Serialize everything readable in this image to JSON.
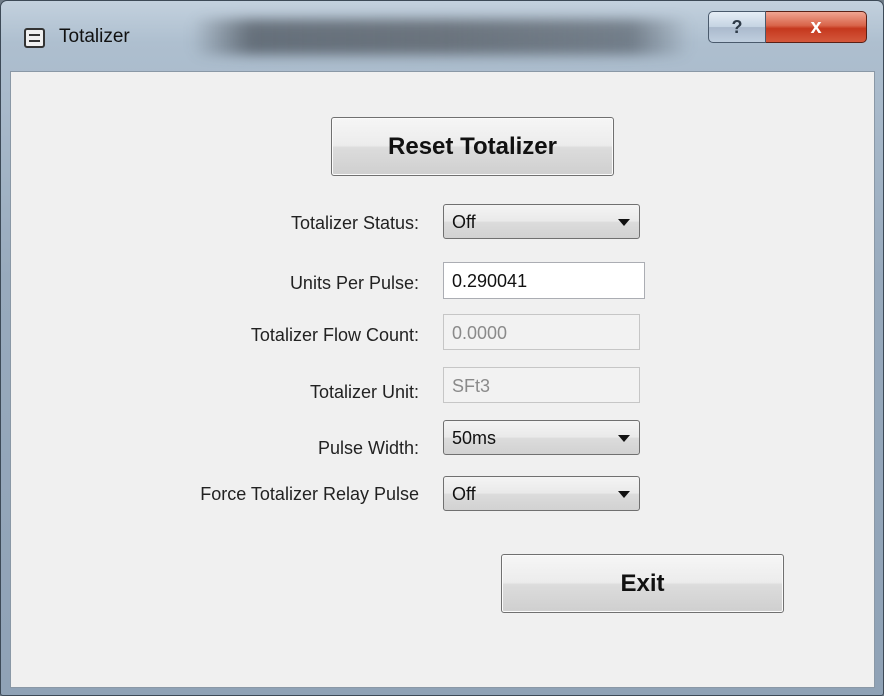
{
  "window": {
    "title": "Totalizer",
    "help_label": "?",
    "close_label": "x"
  },
  "buttons": {
    "reset_label": "Reset Totalizer",
    "exit_label": "Exit"
  },
  "fields": {
    "totalizer_status": {
      "label": "Totalizer Status:",
      "value": "Off"
    },
    "units_per_pulse": {
      "label": "Units Per Pulse:",
      "value": "0.290041"
    },
    "flow_count": {
      "label": "Totalizer Flow Count:",
      "value": "0.0000"
    },
    "totalizer_unit": {
      "label": "Totalizer Unit:",
      "value": "SFt3"
    },
    "pulse_width": {
      "label": "Pulse Width:",
      "value": "50ms"
    },
    "force_relay": {
      "label": "Force Totalizer Relay Pulse",
      "value": "Off"
    }
  }
}
